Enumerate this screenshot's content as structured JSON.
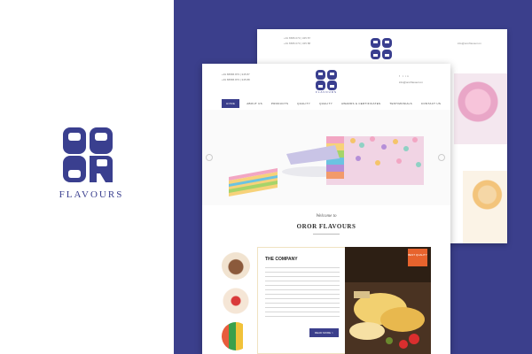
{
  "brand": {
    "mark_text": "OROR",
    "wordmark": "FLAVOURS",
    "color": "#3a3f8f"
  },
  "colors": {
    "panel": "#3b3f8c",
    "accent": "#e7632d"
  },
  "back_screen": {
    "phone_1": "+91 6586 073 | 345 87",
    "phone_2": "+91 6586 073 | 345 88",
    "email": "info@ororflavours.in"
  },
  "front_screen": {
    "phone_1": "+91 86586 873 | 345 87",
    "phone_2": "+91 86586 873 | 345 88",
    "email": "info@ororflavours.in",
    "logo_sub": "FLAVOURS",
    "nav": [
      {
        "label": "HOME",
        "active": true
      },
      {
        "label": "ABOUT US",
        "active": false
      },
      {
        "label": "PRODUCTS",
        "active": false
      },
      {
        "label": "QUALITY",
        "active": false
      },
      {
        "label": "QUALITY",
        "active": false
      },
      {
        "label": "AWARDS & CERTIFICATES",
        "active": false
      },
      {
        "label": "TESTIMONIALS",
        "active": false
      },
      {
        "label": "CONTACT US",
        "active": false
      }
    ],
    "welcome": "Welcome to",
    "title": "OROR FLAVOURS",
    "company": {
      "heading": "THE COMPANY",
      "button": "READ MORE >"
    },
    "badge": "BEST QUALITY"
  }
}
